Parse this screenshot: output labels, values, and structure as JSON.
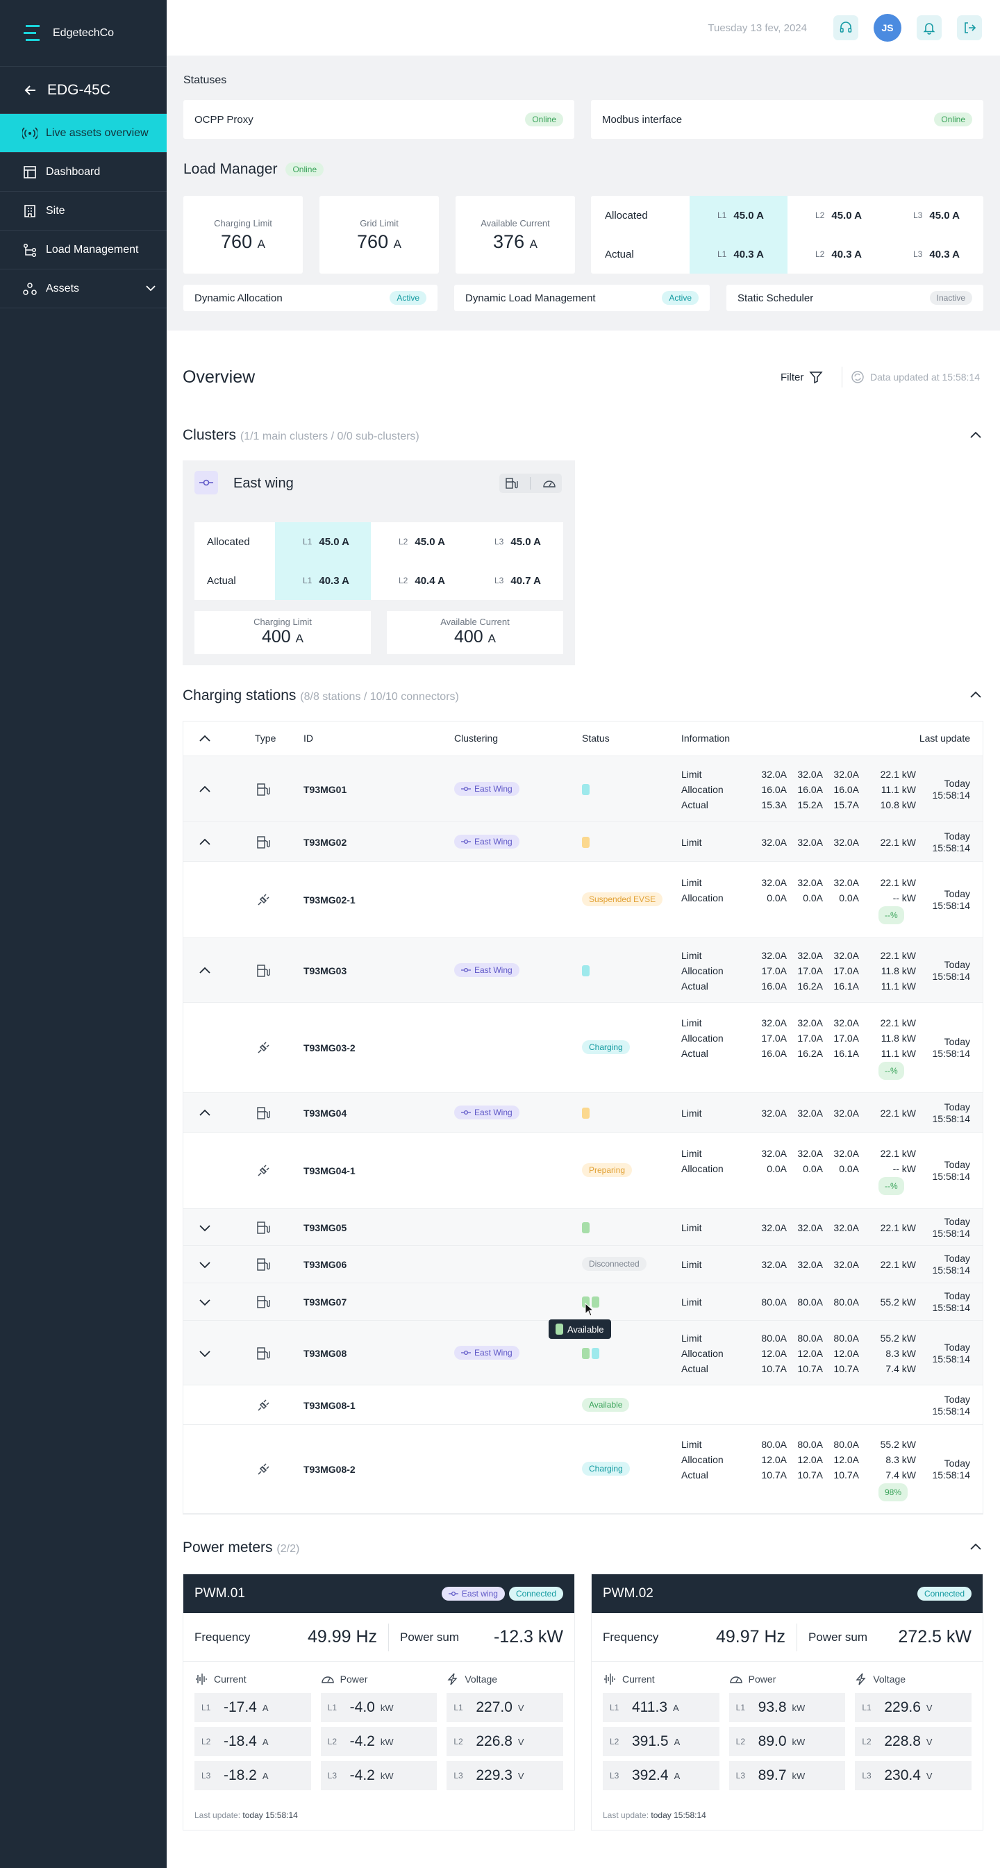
{
  "brand": {
    "name": "EdgetechCo"
  },
  "site": {
    "name": "EDG-45C"
  },
  "nav": [
    {
      "label": "Live assets overview",
      "icon": "broadcast-icon"
    },
    {
      "label": "Dashboard",
      "icon": "grid-icon"
    },
    {
      "label": "Site",
      "icon": "building-icon"
    },
    {
      "label": "Load Management",
      "icon": "nodes-icon"
    },
    {
      "label": "Assets",
      "icon": "assets-icon"
    }
  ],
  "header": {
    "date": "Tuesday 13 fev, 2024",
    "avatar": "JS"
  },
  "statuses": {
    "title": "Statuses",
    "items": [
      {
        "name": "OCPP Proxy",
        "status": "Online"
      },
      {
        "name": "Modbus interface",
        "status": "Online"
      }
    ]
  },
  "load_manager": {
    "title": "Load Manager",
    "status": "Online",
    "metrics": [
      {
        "label": "Charging Limit",
        "value": "760",
        "unit": "A"
      },
      {
        "label": "Grid Limit",
        "value": "760",
        "unit": "A"
      },
      {
        "label": "Available Current",
        "value": "376",
        "unit": "A"
      }
    ],
    "table": {
      "rows": [
        {
          "label": "Allocated",
          "l1": "45.0 A",
          "l2": "45.0 A",
          "l3": "45.0 A"
        },
        {
          "label": "Actual",
          "l1": "40.3 A",
          "l2": "40.3 A",
          "l3": "40.3 A"
        }
      ]
    },
    "features": [
      {
        "name": "Dynamic Allocation",
        "status": "Active"
      },
      {
        "name": "Dynamic Load Management",
        "status": "Active"
      },
      {
        "name": "Static Scheduler",
        "status": "Inactive"
      }
    ]
  },
  "phases": {
    "l1": "L1",
    "l2": "L2",
    "l3": "L3"
  },
  "overview": {
    "title": "Overview",
    "filter": "Filter",
    "updated": "Data updated at 15:58:14"
  },
  "clusters": {
    "title": "Clusters",
    "count": "(1/1 main clusters / 0/0 sub-clusters)",
    "items": [
      {
        "name": "East wing",
        "rows": [
          {
            "label": "Allocated",
            "l1": "45.0 A",
            "l2": "45.0 A",
            "l3": "45.0 A"
          },
          {
            "label": "Actual",
            "l1": "40.3 A",
            "l2": "40.4 A",
            "l3": "40.7 A"
          }
        ],
        "metrics": [
          {
            "label": "Charging Limit",
            "value": "400",
            "unit": "A"
          },
          {
            "label": "Available Current",
            "value": "400",
            "unit": "A"
          }
        ]
      }
    ]
  },
  "stations": {
    "title": "Charging stations",
    "count": "(8/8 stations / 10/10 connectors)",
    "columns": {
      "type": "Type",
      "id": "ID",
      "clustering": "Clustering",
      "status": "Status",
      "information": "Information",
      "last_update": "Last update"
    },
    "labels": {
      "limit": "Limit",
      "allocation": "Allocation",
      "actual": "Actual",
      "today": "Today",
      "time": "15:58:14"
    },
    "rows": [
      {
        "id": "T93MG01",
        "cluster": "East Wing",
        "dots": [
          "teal"
        ],
        "info": [
          [
            "Limit",
            "32.0A",
            "32.0A",
            "32.0A",
            "22.1 kW"
          ],
          [
            "Allocation",
            "16.0A",
            "16.0A",
            "16.0A",
            "11.1 kW"
          ],
          [
            "Actual",
            "15.3A",
            "15.2A",
            "15.7A",
            "10.8 kW"
          ]
        ]
      },
      {
        "id": "T93MG02",
        "cluster": "East Wing",
        "dots": [
          "orange"
        ],
        "info": [
          [
            "Limit",
            "32.0A",
            "32.0A",
            "32.0A",
            "22.1 kW"
          ]
        ]
      },
      {
        "id": "T93MG02-1",
        "status": "Suspended EVSE",
        "info": [
          [
            "Limit",
            "32.0A",
            "32.0A",
            "32.0A",
            "22.1 kW"
          ],
          [
            "Allocation",
            "0.0A",
            "0.0A",
            "0.0A",
            "-- kW"
          ]
        ],
        "pct": "--%"
      },
      {
        "id": "T93MG03",
        "cluster": "East Wing",
        "dots": [
          "teal"
        ],
        "info": [
          [
            "Limit",
            "32.0A",
            "32.0A",
            "32.0A",
            "22.1 kW"
          ],
          [
            "Allocation",
            "17.0A",
            "17.0A",
            "17.0A",
            "11.8 kW"
          ],
          [
            "Actual",
            "16.0A",
            "16.2A",
            "16.1A",
            "11.1 kW"
          ]
        ]
      },
      {
        "id": "T93MG03-2",
        "status": "Charging",
        "info": [
          [
            "Limit",
            "32.0A",
            "32.0A",
            "32.0A",
            "22.1 kW"
          ],
          [
            "Allocation",
            "17.0A",
            "17.0A",
            "17.0A",
            "11.8 kW"
          ],
          [
            "Actual",
            "16.0A",
            "16.2A",
            "16.1A",
            "11.1 kW"
          ]
        ],
        "pct": "--%"
      },
      {
        "id": "T93MG04",
        "cluster": "East Wing",
        "dots": [
          "orange"
        ],
        "info": [
          [
            "Limit",
            "32.0A",
            "32.0A",
            "32.0A",
            "22.1 kW"
          ]
        ]
      },
      {
        "id": "T93MG04-1",
        "status": "Preparing",
        "info": [
          [
            "Limit",
            "32.0A",
            "32.0A",
            "32.0A",
            "22.1 kW"
          ],
          [
            "Allocation",
            "0.0A",
            "0.0A",
            "0.0A",
            "-- kW"
          ]
        ],
        "pct": "--%"
      },
      {
        "id": "T93MG05",
        "dots": [
          "green"
        ],
        "info": [
          [
            "Limit",
            "32.0A",
            "32.0A",
            "32.0A",
            "22.1 kW"
          ]
        ]
      },
      {
        "id": "T93MG06",
        "status": "Disconnected",
        "info": [
          [
            "Limit",
            "32.0A",
            "32.0A",
            "32.0A",
            "22.1 kW"
          ]
        ]
      },
      {
        "id": "T93MG07",
        "dots": [
          "green",
          "green"
        ],
        "info": [
          [
            "Limit",
            "80.0A",
            "80.0A",
            "80.0A",
            "55.2 kW"
          ]
        ]
      },
      {
        "id": "T93MG08",
        "cluster": "East Wing",
        "dots": [
          "green",
          "teal"
        ],
        "info": [
          [
            "Limit",
            "80.0A",
            "80.0A",
            "80.0A",
            "55.2 kW"
          ],
          [
            "Allocation",
            "12.0A",
            "12.0A",
            "12.0A",
            "8.3 kW"
          ],
          [
            "Actual",
            "10.7A",
            "10.7A",
            "10.7A",
            "7.4 kW"
          ]
        ]
      },
      {
        "id": "T93MG08-1",
        "status": "Available",
        "info": []
      },
      {
        "id": "T93MG08-2",
        "status": "Charging",
        "info": [
          [
            "Limit",
            "80.0A",
            "80.0A",
            "80.0A",
            "55.2 kW"
          ],
          [
            "Allocation",
            "12.0A",
            "12.0A",
            "12.0A",
            "8.3 kW"
          ],
          [
            "Actual",
            "10.7A",
            "10.7A",
            "10.7A",
            "7.4 kW"
          ]
        ],
        "pct": "98%"
      }
    ],
    "tooltip": "Available"
  },
  "power_meters": {
    "title": "Power meters",
    "count": "(2/2)",
    "labels": {
      "frequency": "Frequency",
      "power_sum": "Power sum",
      "current": "Current",
      "power": "Power",
      "voltage": "Voltage",
      "last_update": "Last update:",
      "u_current": "A",
      "u_power": "kW",
      "u_voltage": "V"
    },
    "items": [
      {
        "name": "PWM.01",
        "cluster": "East wing",
        "status": "Connected",
        "frequency": "49.99 Hz",
        "power_sum": "-12.3 kW",
        "current": [
          "-17.4",
          "-18.4",
          "-18.2"
        ],
        "power": [
          "-4.0",
          "-4.2",
          "-4.2"
        ],
        "voltage": [
          "227.0",
          "226.8",
          "229.3"
        ],
        "updated": "today 15:58:14"
      },
      {
        "name": "PWM.02",
        "status": "Connected",
        "frequency": "49.97 Hz",
        "power_sum": "272.5 kW",
        "current": [
          "411.3",
          "391.5",
          "392.4"
        ],
        "power": [
          "93.8",
          "89.0",
          "89.7"
        ],
        "voltage": [
          "229.6",
          "228.8",
          "230.4"
        ],
        "updated": "today 15:58:14"
      }
    ]
  }
}
